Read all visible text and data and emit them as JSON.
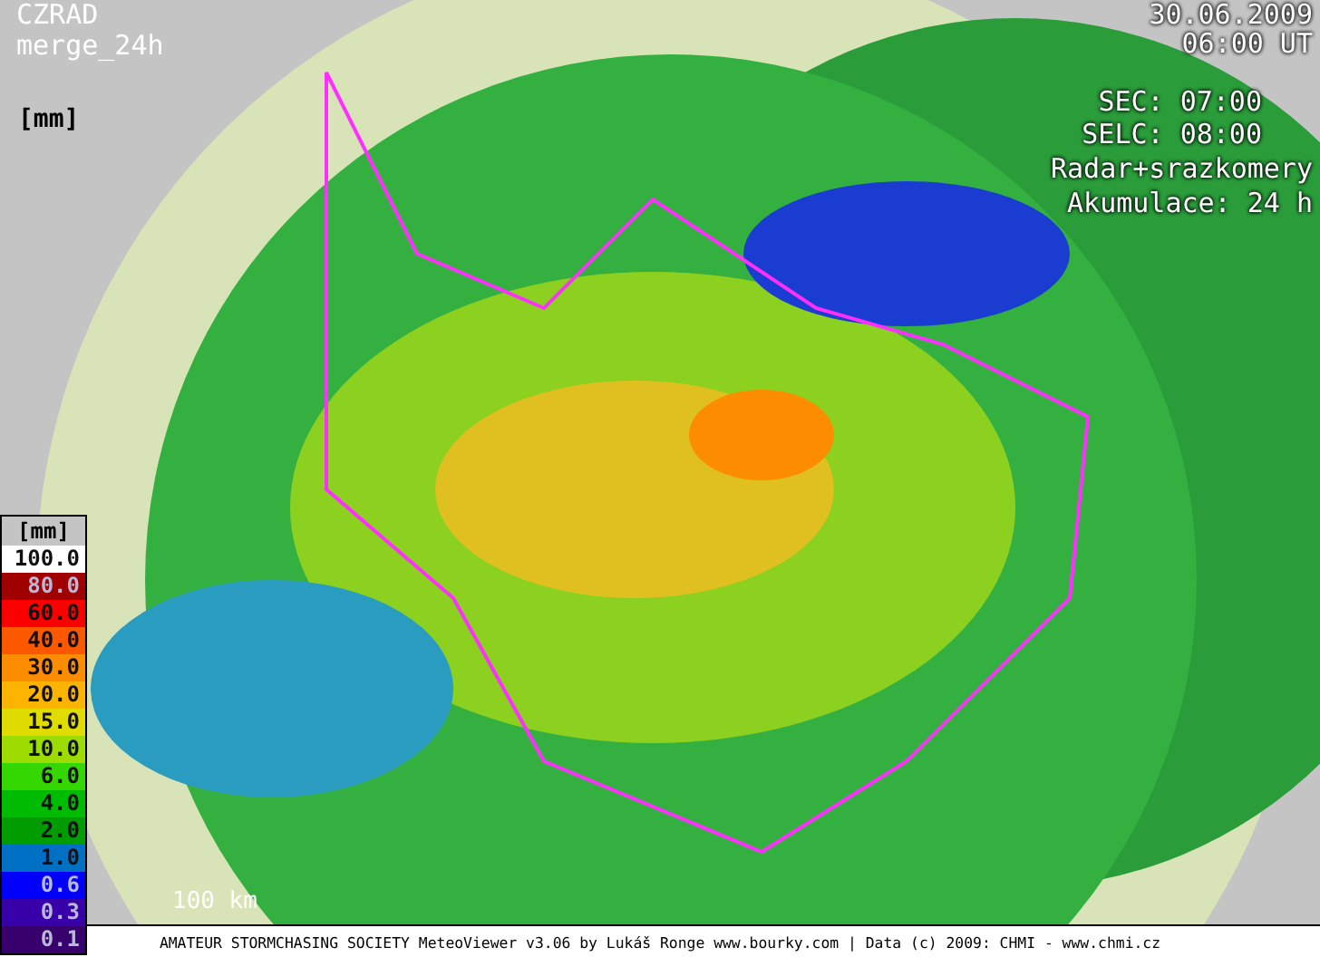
{
  "header": {
    "title": "CZRAD",
    "product": "merge_24h",
    "unit": "[mm]"
  },
  "info": {
    "date": "30.06.2009",
    "time": "06:00 UT",
    "sec": "SEC: 07:00",
    "selc": "SELC: 08:00",
    "source": "Radar+srazkomery",
    "accumulation": "Akumulace: 24 h"
  },
  "legend": {
    "title": "[mm]",
    "items": [
      {
        "label": "100.0",
        "color": "#ffffff"
      },
      {
        "label": "80.0",
        "color": "#a00000"
      },
      {
        "label": "60.0",
        "color": "#fc0000"
      },
      {
        "label": "40.0",
        "color": "#fc5800"
      },
      {
        "label": "30.0",
        "color": "#fc8c00"
      },
      {
        "label": "20.0",
        "color": "#fcb400"
      },
      {
        "label": "15.0",
        "color": "#e0dc00"
      },
      {
        "label": "10.0",
        "color": "#9cdc00"
      },
      {
        "label": "6.0",
        "color": "#34d800"
      },
      {
        "label": "4.0",
        "color": "#00bc00"
      },
      {
        "label": "2.0",
        "color": "#009c00"
      },
      {
        "label": "1.0",
        "color": "#0070c4"
      },
      {
        "label": "0.6",
        "color": "#0000fc"
      },
      {
        "label": "0.3",
        "color": "#3800a8"
      },
      {
        "label": "0.1",
        "color": "#38006c"
      }
    ]
  },
  "scale": "100 km",
  "footer": "AMATEUR STORMCHASING SOCIETY MeteoViewer v3.06 by Lukáš Ronge www.bourky.com | Data (c) 2009: CHMI - www.chmi.cz"
}
